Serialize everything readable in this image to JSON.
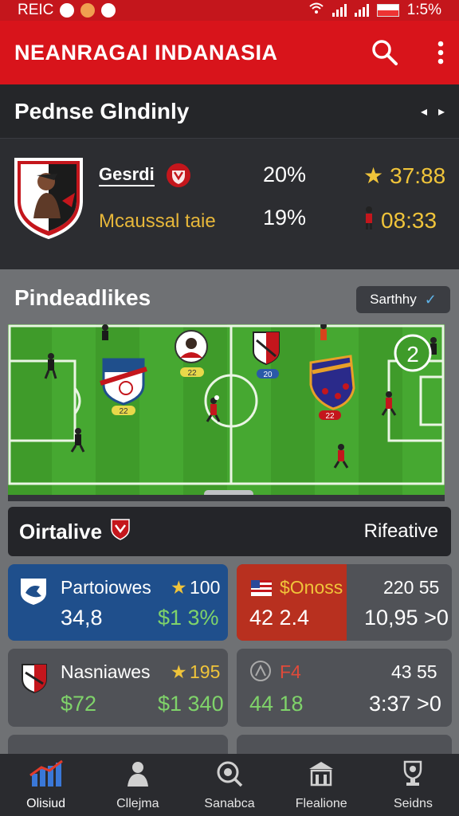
{
  "status_bar": {
    "left_text": "REIC",
    "time": "1:5%"
  },
  "app_bar": {
    "title": "NEANRAGAI INDANASIA",
    "search_icon": "search-icon",
    "menu_icon": "more-vert-icon"
  },
  "league": {
    "title": "Pednse Glndinly",
    "team1": {
      "name": "Gesrdi",
      "pct": "20%",
      "score": "37:88"
    },
    "team2": {
      "name": "Mcaussal taie",
      "pct": "19%",
      "score": "08:33"
    }
  },
  "pitch_section": {
    "title": "Pindeadlikes",
    "sort_label": "Sarthhy",
    "badge_number": "2",
    "chip_labels": [
      "22",
      "22",
      "20",
      "22"
    ]
  },
  "ratings": {
    "left": "Oirtalive",
    "right": "Rifeative"
  },
  "cards": [
    {
      "name": "Partoiowes",
      "star_value": "100",
      "v1": "34,8",
      "v2": "$1 3%"
    },
    {
      "name": "$Onoss",
      "right_top": "220 55",
      "v1": "42 2.4",
      "v2": "10,95 >0"
    },
    {
      "name": "Nasniawes",
      "star_value": "195",
      "v1": "$72",
      "v2": "$1 340"
    },
    {
      "name": "F4",
      "right_top": "43 55",
      "v1": "44 18",
      "v2": "3:37 >0"
    }
  ],
  "bottom_nav": [
    {
      "label": "Olisiud",
      "icon": "chart-icon"
    },
    {
      "label": "Cllejma",
      "icon": "person-icon"
    },
    {
      "label": "Sanabca",
      "icon": "search-ball-icon"
    },
    {
      "label": "Flealione",
      "icon": "building-icon"
    },
    {
      "label": "Seidns",
      "icon": "trophy-icon"
    }
  ],
  "colors": {
    "primary": "#d8141b",
    "card_blue": "#1f4f8c",
    "gold": "#f0c43a",
    "green": "#7fd36a",
    "pitch": "#43a52e"
  }
}
